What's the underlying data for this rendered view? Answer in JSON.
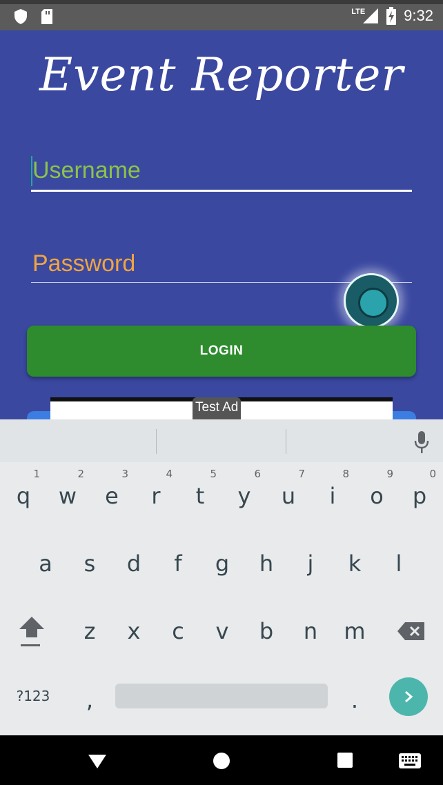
{
  "status_bar": {
    "left_icons": [
      "shield-icon",
      "sd-card-icon"
    ],
    "network": "LTE",
    "time": "9:32"
  },
  "app": {
    "title": "Event Reporter",
    "username_placeholder": "Username",
    "password_placeholder": "Password",
    "login_label": "LOGIN",
    "ad_label": "Test Ad",
    "colors": {
      "background": "#3a48a0",
      "username_hint": "#8bc34a",
      "password_hint": "#f0a540",
      "login_button": "#2e8b2e"
    }
  },
  "keyboard": {
    "row1": [
      {
        "key": "q",
        "hint": "1"
      },
      {
        "key": "w",
        "hint": "2"
      },
      {
        "key": "e",
        "hint": "3"
      },
      {
        "key": "r",
        "hint": "4"
      },
      {
        "key": "t",
        "hint": "5"
      },
      {
        "key": "y",
        "hint": "6"
      },
      {
        "key": "u",
        "hint": "7"
      },
      {
        "key": "i",
        "hint": "8"
      },
      {
        "key": "o",
        "hint": "9"
      },
      {
        "key": "p",
        "hint": "0"
      }
    ],
    "row2": [
      "a",
      "s",
      "d",
      "f",
      "g",
      "h",
      "j",
      "k",
      "l"
    ],
    "row3": [
      "z",
      "x",
      "c",
      "v",
      "b",
      "n",
      "m"
    ],
    "symbols_label": "?123",
    "comma": ",",
    "period": "."
  },
  "nav_bar": {
    "buttons": [
      "back-icon",
      "home-icon",
      "recents-icon",
      "keyboard-switch-icon"
    ]
  }
}
